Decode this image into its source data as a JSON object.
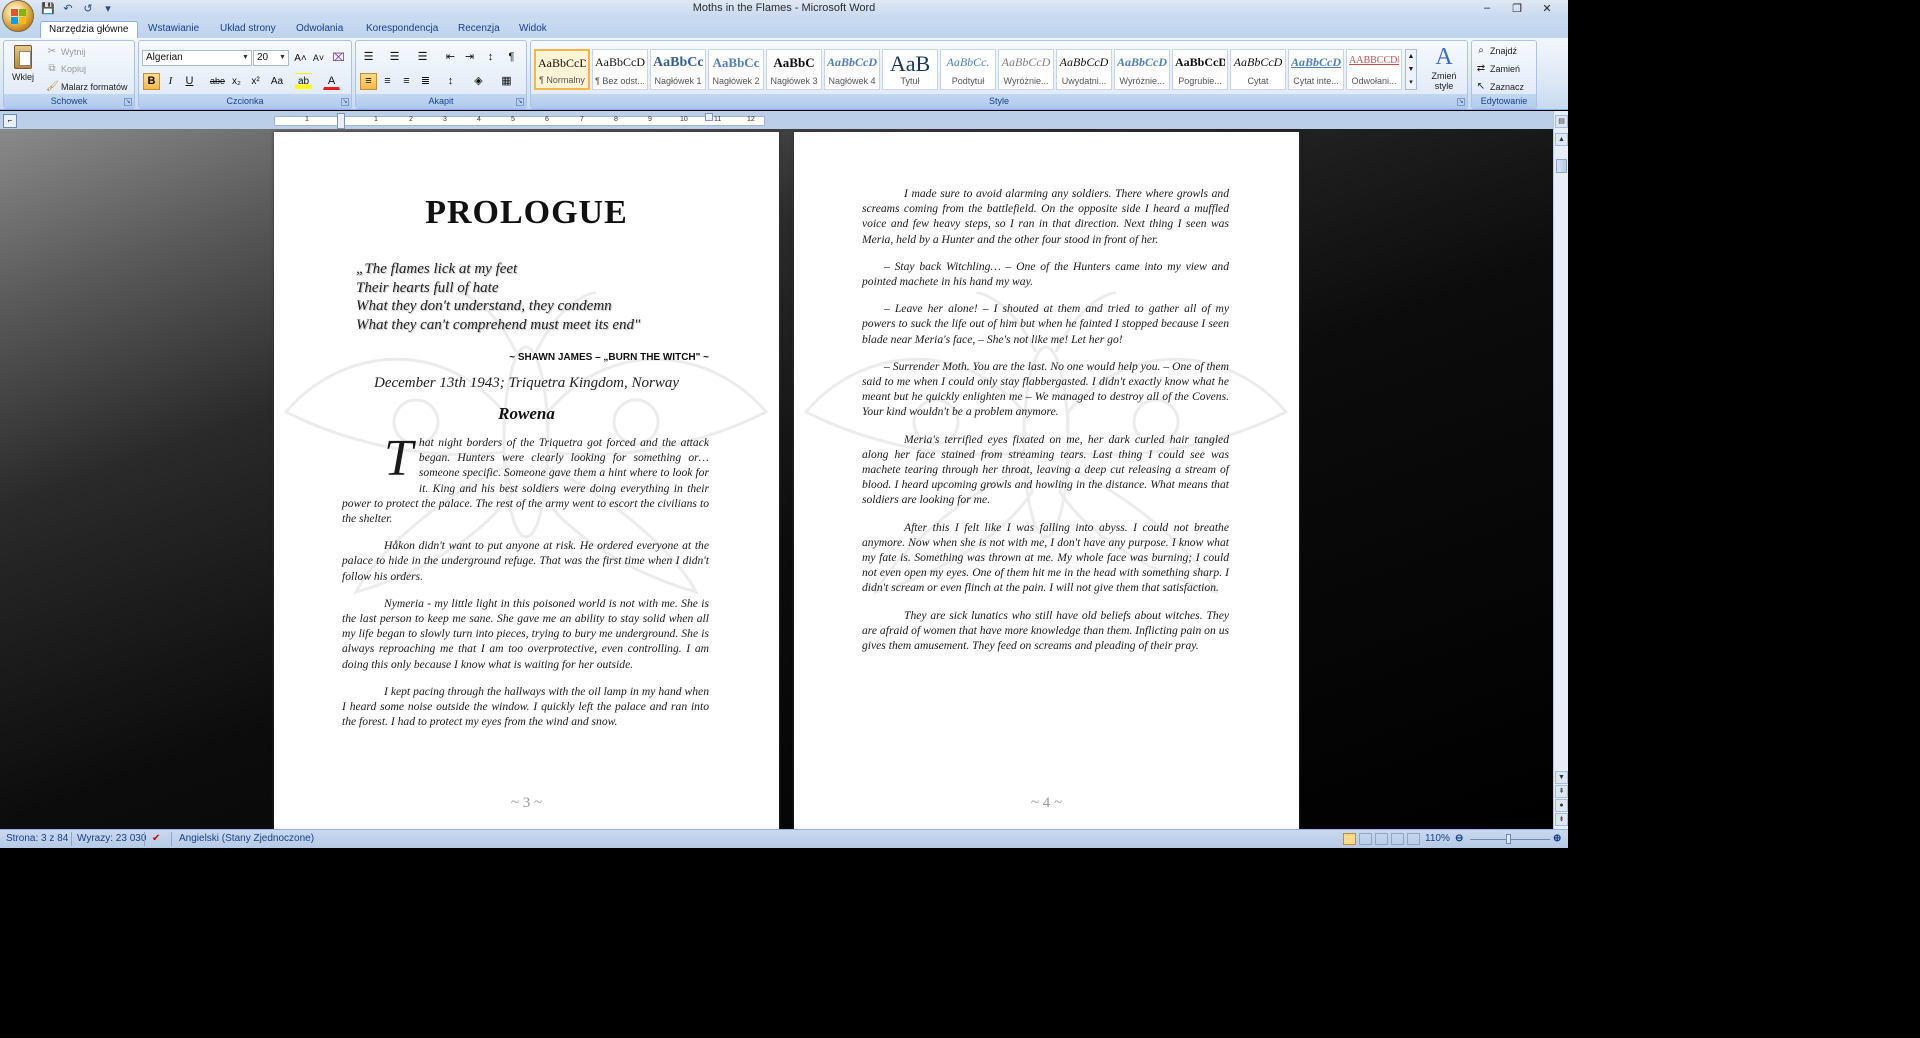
{
  "window": {
    "title": "Moths in the Flames - Microsoft Word",
    "minimize": "–",
    "maximize": "❐",
    "close": "✕"
  },
  "qat": {
    "save_icon": "💾",
    "undo_icon": "↶",
    "redo_icon": "↺",
    "more_icon": "▾"
  },
  "tabs": [
    {
      "label": "Narzędzia główne"
    },
    {
      "label": "Wstawianie"
    },
    {
      "label": "Układ strony"
    },
    {
      "label": "Odwołania"
    },
    {
      "label": "Korespondencja"
    },
    {
      "label": "Recenzja"
    },
    {
      "label": "Widok"
    }
  ],
  "clipboard": {
    "paste": "Wklej",
    "cut": "Wytnij",
    "copy": "Kopiuj",
    "painter": "Malarz formatów",
    "group": "Schowek"
  },
  "font": {
    "name": "Algerian",
    "size": "20",
    "group": "Czcionka",
    "grow": "A˄",
    "shrink": "A˅",
    "clear": "⌧",
    "bold": "B",
    "italic": "I",
    "underline": "U",
    "strike": "abe",
    "sub": "x₂",
    "sup": "x²",
    "case": "Aa",
    "highlight": "ab",
    "color": "A"
  },
  "paragraph": {
    "group": "Akapit",
    "bullets": "☰",
    "numbering": "☰",
    "multilevel": "☰",
    "dec_indent": "⇤",
    "inc_indent": "⇥",
    "sort": "↕",
    "pilcrow": "¶"
  },
  "styles": {
    "group": "Style",
    "items": [
      {
        "sample": "AaBbCcDc",
        "name": "¶ Normalny"
      },
      {
        "sample": "AaBbCcDc",
        "name": "¶ Bez odst..."
      },
      {
        "sample": "AaBbCc",
        "name": "Nagłówek 1"
      },
      {
        "sample": "AaBbCc",
        "name": "Nagłówek 2"
      },
      {
        "sample": "AaBbC",
        "name": "Nagłówek 3"
      },
      {
        "sample": "AaBbCcD",
        "name": "Nagłówek 4"
      },
      {
        "sample": "AaB",
        "name": "Tytuł"
      },
      {
        "sample": "AaBbCc.",
        "name": "Podtytuł"
      },
      {
        "sample": "AaBbCcD",
        "name": "Wyróżnie..."
      },
      {
        "sample": "AaBbCcD",
        "name": "Uwydatni..."
      },
      {
        "sample": "AaBbCcD",
        "name": "Wyróżnie..."
      },
      {
        "sample": "AaBbCcD",
        "name": "Pogrubie..."
      },
      {
        "sample": "AaBbCcD",
        "name": "Cytat"
      },
      {
        "sample": "AaBbCcD",
        "name": "Cytat inte..."
      },
      {
        "sample": "AABBCCDD",
        "name": "Odwołani..."
      }
    ],
    "change_styles": "Zmień style"
  },
  "editing": {
    "find": "Znajdź",
    "replace": "Zamień",
    "select": "Zaznacz",
    "group": "Edytowanie"
  },
  "ruler": {
    "numbers": [
      "1",
      "2",
      "1",
      "2",
      "3",
      "4",
      "5",
      "6",
      "7",
      "8",
      "9",
      "10",
      "11",
      "12"
    ]
  },
  "page_left": {
    "title": "PROLOGUE",
    "poem": [
      "„The flames lick at my feet",
      "Their hearts full of hate",
      "What they don't understand, they condemn",
      "What they can't comprehend must meet its end\""
    ],
    "attribution": "~ SHAWN JAMES – „BURN THE WITCH\" ~",
    "date_line": "December 13th 1943; Triquetra Kingdom, Norway",
    "narrator": "Rowena",
    "dropcap": "T",
    "first_paragraph": "hat night borders of the Triquetra got forced and the attack began. Hunters were clearly looking for something or… someone specific. Someone gave them a hint where to look for it. King and his best soldiers were doing everything in their power to protect the palace. The rest of the army went to escort the civilians to the shelter.",
    "paragraphs": [
      "Håkon didn't want to put anyone at risk. He ordered everyone at the palace to hide in the underground refuge. That was the first time when I didn't follow his orders.",
      "Nymeria - my little light in this poisoned world is not with me. She is the last person to keep me sane. She gave me an ability to stay solid when all my life began to slowly turn into pieces, trying to bury me underground. She is always reproaching me that I am too overprotective, even controlling. I am doing this only because I know what is waiting for her outside.",
      "I kept pacing through the hallways with the oil lamp in my hand when I heard some noise outside the window. I quickly left the palace and ran into the forest. I had to protect my eyes from the wind and snow."
    ],
    "page_number": "~ 3 ~"
  },
  "page_right": {
    "paragraphs": [
      "I made sure to avoid alarming any soldiers. There where growls and screams coming from the battlefield. On the opposite side I heard a muffled voice and few heavy steps, so I ran in that direction. Next thing I seen was Meria, held by a Hunter and the other four stood in front of her.",
      "– Stay back Witchling… – One of the Hunters came into my view and pointed machete in his hand my way.",
      "– Leave her alone! – I shouted at them and tried to gather all of my powers to suck the life out of him but when he fainted I stopped because I seen blade near Meria's face, – She's not like me! Let her go!",
      "– Surrender Moth. You are the last. No one would help you. – One of them said to me when I could only stay flabbergasted. I didn't exactly know what he meant but he quickly enlighten me – We managed to destroy all of the Covens. Your kind wouldn't be a problem anymore.",
      "Meria's terrified eyes fixated on me, her dark curled hair tangled along her face stained from streaming tears. Last thing I could see was machete tearing through her throat, leaving a deep cut releasing a stream of blood. I heard upcoming growls and howling in the distance. What means that soldiers are looking for me.",
      "After this I felt like I was falling into abyss. I could not breathe anymore. Now when she is not with me, I don't have any purpose. I know what my fate is. Something was thrown at me. My whole face was burning; I could not even open my eyes. One of them hit me in the head with something sharp. I didn't scream or even flinch at the pain. I will not give them that satisfaction.",
      "They are sick lunatics who still have old beliefs about witches. They are afraid of women that have more knowledge than them. Inflicting pain on us gives them amusement. They feed on screams and pleading of their pray."
    ],
    "page_number": "~ 4 ~"
  },
  "status": {
    "page": "Strona: 3 z 84",
    "words": "Wyrazy: 23 030",
    "language": "Angielski (Stany Zjednoczone)",
    "zoom": "110%"
  }
}
